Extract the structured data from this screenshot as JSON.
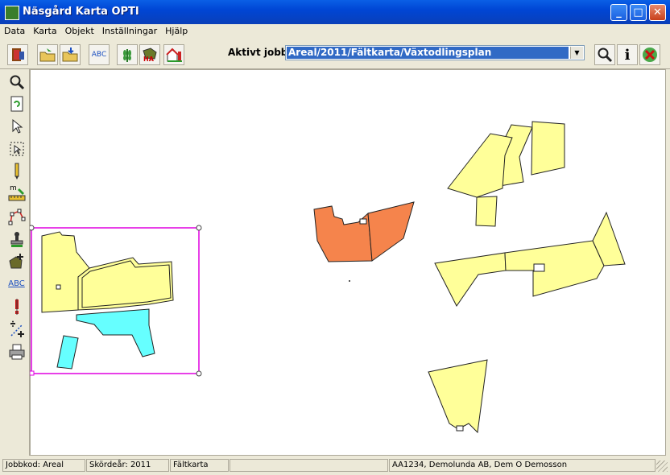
{
  "window": {
    "title": "Näsgård Karta OPTI"
  },
  "menu": [
    "Data",
    "Karta",
    "Objekt",
    "Inställningar",
    "Hjälp"
  ],
  "toolbar": {
    "abc_label": "ABC",
    "ha_label": "HA",
    "aktiv_label": "Aktivt jobb",
    "aktiv_value": "Areal/2011/Fältkarta/Växtodlingsplan"
  },
  "lefttools": {
    "abc_label": "ABC",
    "measure_label": "m"
  },
  "status": {
    "jobbkod": "Jobbkod: Areal",
    "skordear": "Skördeår: 2011",
    "vy": "Fältkarta",
    "empty": "",
    "kund": "AA1234, Demolunda AB, Dem O Demosson"
  },
  "colors": {
    "field_yellow": "#ffff99",
    "field_orange": "#f5844c",
    "field_cyan": "#66ffff",
    "selection": "#e000e0",
    "highlight": "#316ac5"
  }
}
